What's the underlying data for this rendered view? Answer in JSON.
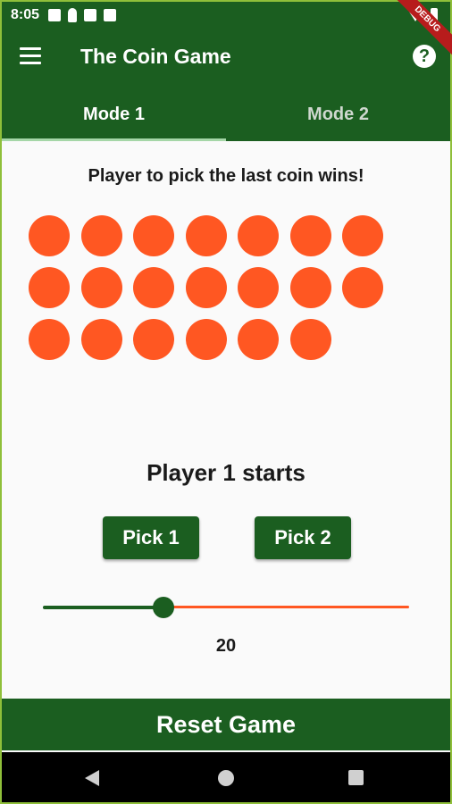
{
  "status_bar": {
    "time": "8:05",
    "debug_label": "DEBUG"
  },
  "app_bar": {
    "title": "The Coin Game",
    "help_icon": "?"
  },
  "tabs": [
    {
      "label": "Mode 1",
      "active": true
    },
    {
      "label": "Mode 2",
      "active": false
    }
  ],
  "instruction": "Player to pick the last coin wins!",
  "coins": {
    "count": 20,
    "color": "#ff5722"
  },
  "status": "Player 1 starts",
  "buttons": {
    "pick1": "Pick 1",
    "pick2": "Pick 2"
  },
  "slider": {
    "value": "20",
    "fraction": 0.33
  },
  "reset_label": "Reset Game",
  "colors": {
    "primary": "#1b5e20",
    "accent": "#ff5722",
    "background": "#fafafa"
  },
  "icons": [
    "menu-icon",
    "help-icon",
    "mail-icon",
    "person-icon",
    "sim-icon",
    "wifi-icon",
    "battery-icon",
    "back-icon",
    "home-icon",
    "recents-icon"
  ]
}
